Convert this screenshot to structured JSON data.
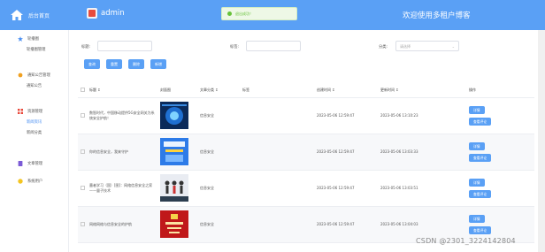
{
  "header": {
    "logo_text": "后台首页",
    "admin_label": "admin",
    "toast_text": "退出成功！",
    "welcome": "欢迎使用多租户博客"
  },
  "sidebar": {
    "groups": [
      {
        "label": "轮播图",
        "icon": "star-icon",
        "subs": [
          {
            "label": "轮播图管理",
            "active": false
          }
        ]
      },
      {
        "label": "通知公告管理",
        "icon": "bell-icon",
        "subs": [
          {
            "label": "通知公告",
            "active": false
          }
        ]
      },
      {
        "label": "资源管理",
        "icon": "grid-icon",
        "subs": [
          {
            "label": "新闻资讯",
            "active": true
          },
          {
            "label": "新闻分类",
            "active": false
          }
        ]
      },
      {
        "label": "文章管理",
        "icon": "doc-icon",
        "subs": []
      },
      {
        "label": "系统用户",
        "icon": "user-icon",
        "subs": []
      }
    ]
  },
  "filters": {
    "title_label": "标题:",
    "tag_label": "标签:",
    "category_label": "分类:",
    "category_placeholder": "请选择"
  },
  "toolbar": {
    "search": "查询",
    "reset": "重置",
    "delete": "删除",
    "add": "新增"
  },
  "table": {
    "headers": [
      "标题",
      "封面图",
      "文章分类",
      "标签",
      "创建时间",
      "更新时间",
      "操作"
    ],
    "sort_marker": "↕",
    "rows": [
      {
        "title": "数智时代，中国移动提供5G安全网关为系统安全护航！",
        "category": "信息安全",
        "tag": "",
        "created": "2023-05-06 12:59:47",
        "updated": "2023-05-06 13:10:23",
        "thumb": "blue-tech"
      },
      {
        "title": "你的信息安全，我来守护",
        "category": "信息安全",
        "tag": "",
        "created": "2023-05-06 12:59:47",
        "updated": "2023-05-06 13:03:33",
        "thumb": "blue-poster"
      },
      {
        "title": "墨者学习（国）[图]：网络信息安全之家——量子技术",
        "category": "信息安全",
        "tag": "",
        "created": "2023-05-06 12:59:47",
        "updated": "2023-05-06 13:03:51",
        "thumb": "people"
      },
      {
        "title": "网络网络与信息安全的护航",
        "category": "信息安全",
        "tag": "",
        "created": "2023-05-06 12:59:47",
        "updated": "2023-05-06 13:04:03",
        "thumb": "red-poster"
      }
    ],
    "ops": {
      "detail": "详情",
      "comments": "查看评论"
    }
  },
  "watermark": "CSDN @2301_3224142804"
}
